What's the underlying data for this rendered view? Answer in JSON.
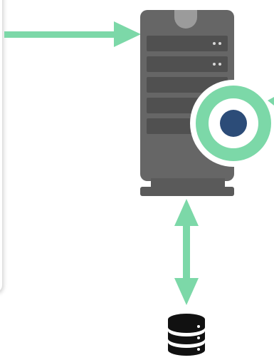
{
  "colors": {
    "arrow": "#7cd8a8",
    "server_body": "#666666",
    "server_slot": "#505050",
    "server_base": "#5a5a5a",
    "badge_ring": "#7cd8a8",
    "badge_dot": "#2c4c78",
    "database": "#111111"
  },
  "icons": {
    "server": "server-tower-icon",
    "badge": "status-ring-icon",
    "database": "database-icon"
  }
}
